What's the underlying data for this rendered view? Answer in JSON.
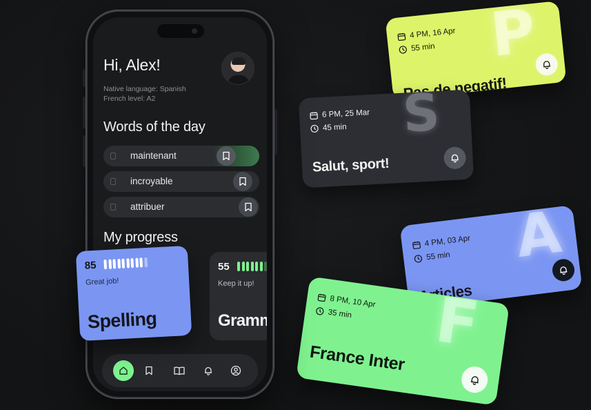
{
  "user": {
    "greeting": "Hi, Alex!",
    "native_language": "Native language: Spanish",
    "french_level": "French level: A2"
  },
  "words_section": {
    "title": "Words of the day",
    "items": [
      {
        "word": "maintenant",
        "bookmarked": true
      },
      {
        "word": "incroyable",
        "bookmarked": false
      },
      {
        "word": "attribuer",
        "bookmarked": false
      }
    ]
  },
  "progress_section": {
    "title": "My progress",
    "cards": [
      {
        "score": "85",
        "message": "Great job!",
        "subject": "Spelling",
        "bar_fill_fraction": 0.85,
        "color": "#7b96f2"
      },
      {
        "score": "55",
        "message": "Keep it up!",
        "subject": "Grammar",
        "bar_fill_fraction": 0.55,
        "color": "#2a2c30"
      }
    ]
  },
  "bottom_nav": {
    "items": [
      {
        "icon": "home-icon",
        "active": true
      },
      {
        "icon": "bookmark-icon",
        "active": false
      },
      {
        "icon": "book-open-icon",
        "active": false
      },
      {
        "icon": "bell-icon",
        "active": false
      },
      {
        "icon": "profile-icon",
        "active": false
      }
    ]
  },
  "lesson_cards": [
    {
      "date": "4 PM, 16 Apr",
      "duration": "55 min",
      "title": "Pas de negatif!",
      "letter": "P",
      "color": "#ddf46a"
    },
    {
      "date": "6 PM, 25 Mar",
      "duration": "45 min",
      "title": "Salut, sport!",
      "letter": "S",
      "color": "#2c2e33"
    },
    {
      "date": "4 PM, 03 Apr",
      "duration": "55 min",
      "title": "Articles",
      "letter": "A",
      "color": "#7b96f2"
    },
    {
      "date": "8 PM, 10 Apr",
      "duration": "35 min",
      "title": "France Inter",
      "letter": "F",
      "color": "#7ff28f"
    }
  ],
  "colors": {
    "accent_green": "#7ff28f",
    "accent_blue": "#7b96f2",
    "accent_yellow": "#ddf46a",
    "background": "#141516"
  }
}
